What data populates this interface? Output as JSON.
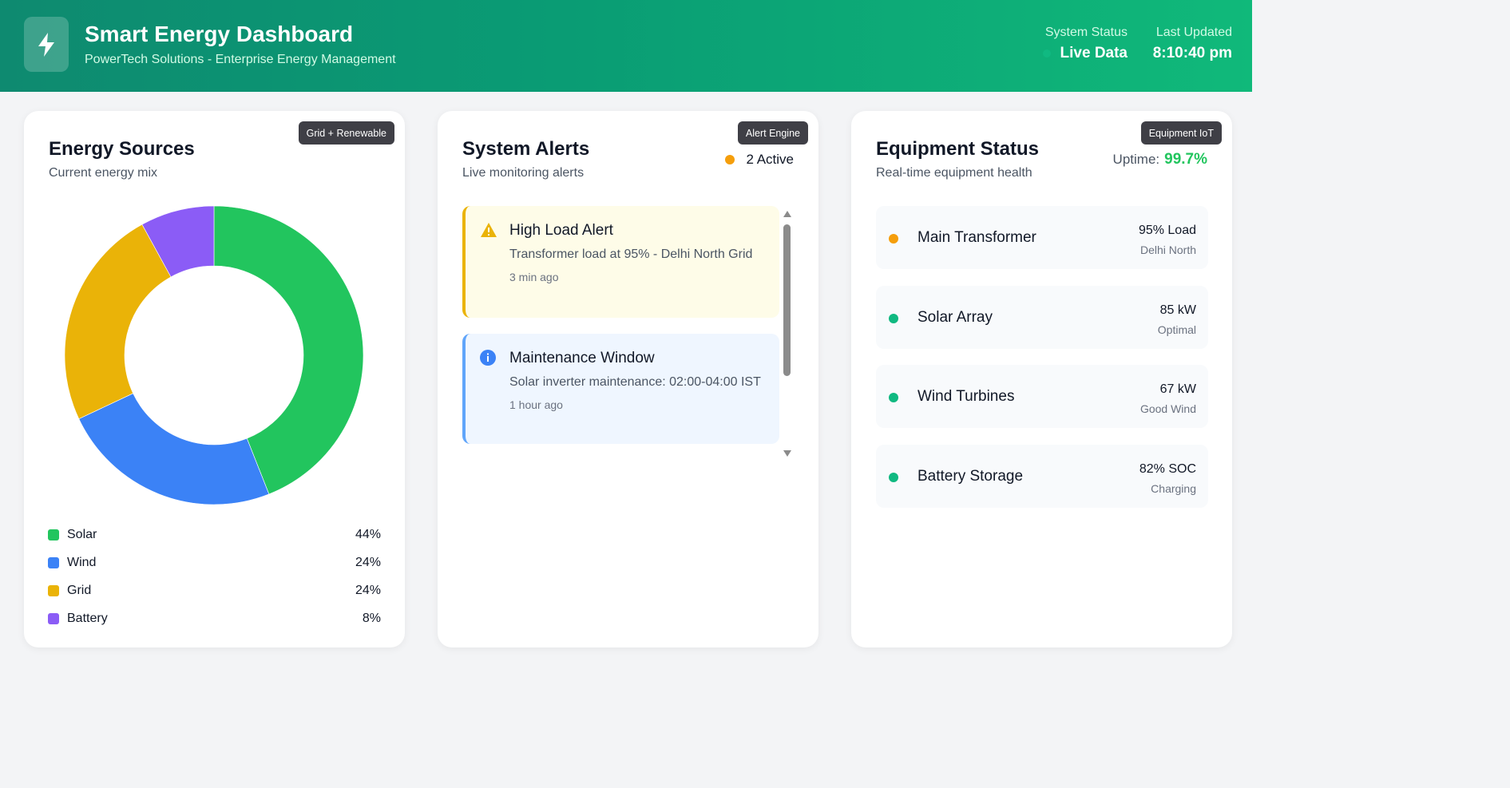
{
  "header": {
    "title": "Smart Energy Dashboard",
    "subtitle": "PowerTech Solutions - Enterprise Energy Management",
    "system_status_label": "System Status",
    "system_status_value": "Live Data",
    "last_updated_label": "Last Updated",
    "last_updated_value": "8:10:40 pm",
    "icon": "lightning-bolt-icon"
  },
  "energy": {
    "tag": "Grid + Renewable",
    "title": "Energy Sources",
    "subtitle": "Current energy mix",
    "sources": [
      {
        "label": "Solar",
        "value": "44%",
        "percent": 44,
        "color": "#22c55e"
      },
      {
        "label": "Wind",
        "value": "24%",
        "percent": 24,
        "color": "#3b82f6"
      },
      {
        "label": "Grid",
        "value": "24%",
        "percent": 24,
        "color": "#eab308"
      },
      {
        "label": "Battery",
        "value": "8%",
        "percent": 8,
        "color": "#8b5cf6"
      }
    ]
  },
  "alerts": {
    "tag": "Alert Engine",
    "title": "System Alerts",
    "subtitle": "Live monitoring alerts",
    "active": "2 Active",
    "items": [
      {
        "title": "High Load Alert",
        "message": "Transformer load at 95% - Delhi North Grid",
        "time": "3 min ago",
        "icon": "warning-triangle-icon",
        "color": "#eab308"
      },
      {
        "title": "Maintenance Window",
        "message": "Solar inverter maintenance: 02:00-04:00 IST",
        "time": "1 hour ago",
        "icon": "info-circle-icon",
        "color": "#3b82f6"
      }
    ]
  },
  "equipment": {
    "tag": "Equipment IoT",
    "title": "Equipment Status",
    "subtitle": "Real-time equipment health",
    "uptime_label": "Uptime:",
    "uptime_value": "99.7%",
    "items": [
      {
        "name": "Main Transformer",
        "value": "95% Load",
        "sub": "Delhi North",
        "status_color": "#f59e0b"
      },
      {
        "name": "Solar Array",
        "value": "85 kW",
        "sub": "Optimal",
        "status_color": "#10b981"
      },
      {
        "name": "Wind Turbines",
        "value": "67 kW",
        "sub": "Good Wind",
        "status_color": "#10b981"
      },
      {
        "name": "Battery Storage",
        "value": "82% SOC",
        "sub": "Charging",
        "status_color": "#10b981"
      }
    ]
  }
}
